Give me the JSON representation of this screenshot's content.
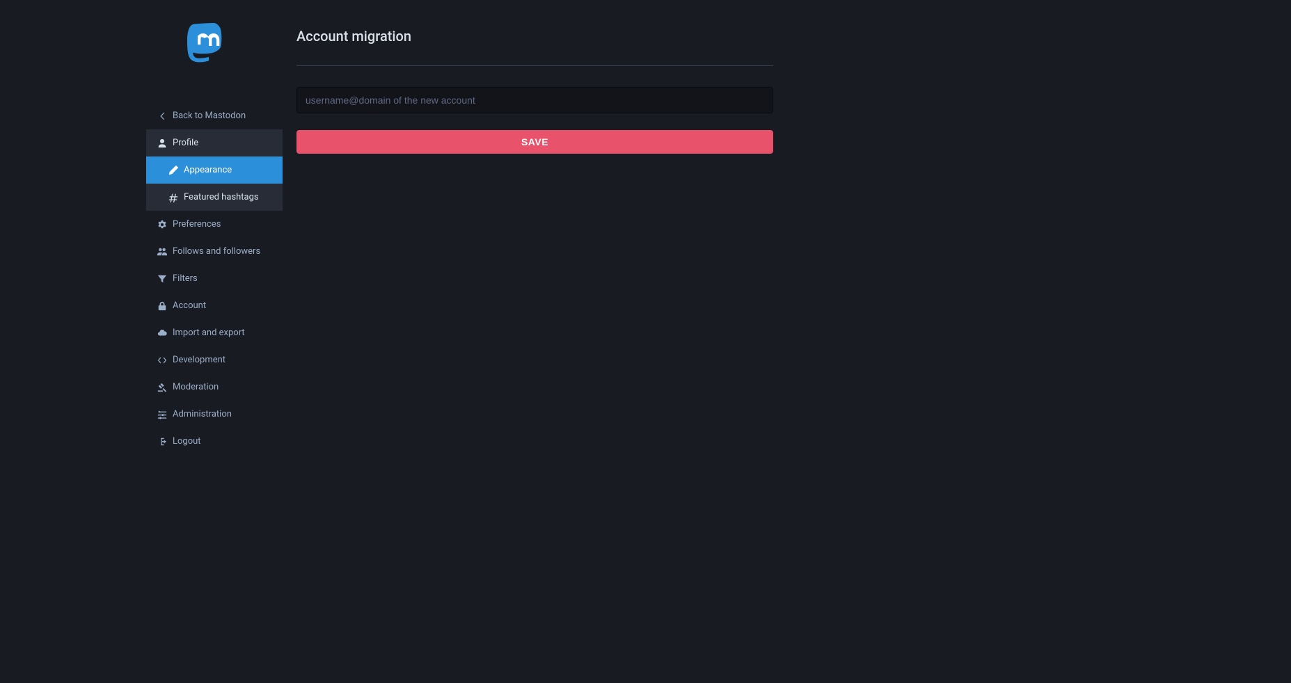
{
  "colors": {
    "accent": "#2b90d9",
    "danger": "#e9526b",
    "bg": "#191b22",
    "panel": "#282c37",
    "input_bg": "#131419"
  },
  "sidebar": {
    "back_label": "Back to Mastodon",
    "items": [
      {
        "label": "Profile",
        "icon": "user-icon",
        "state": "selected"
      },
      {
        "label": "Appearance",
        "icon": "pencil-icon",
        "state": "active",
        "sub": true
      },
      {
        "label": "Featured hashtags",
        "icon": "hashtag-icon",
        "state": "selected",
        "sub": true
      },
      {
        "label": "Preferences",
        "icon": "gear-icon",
        "state": ""
      },
      {
        "label": "Follows and followers",
        "icon": "users-icon",
        "state": ""
      },
      {
        "label": "Filters",
        "icon": "filter-icon",
        "state": ""
      },
      {
        "label": "Account",
        "icon": "lock-icon",
        "state": ""
      },
      {
        "label": "Import and export",
        "icon": "cloud-icon",
        "state": ""
      },
      {
        "label": "Development",
        "icon": "code-icon",
        "state": ""
      },
      {
        "label": "Moderation",
        "icon": "gavel-icon",
        "state": ""
      },
      {
        "label": "Administration",
        "icon": "sliders-icon",
        "state": ""
      },
      {
        "label": "Logout",
        "icon": "logout-icon",
        "state": ""
      }
    ]
  },
  "main": {
    "title": "Account migration",
    "account_handle_placeholder": "username@domain of the new account",
    "account_handle_value": "",
    "save_label": "SAVE"
  }
}
